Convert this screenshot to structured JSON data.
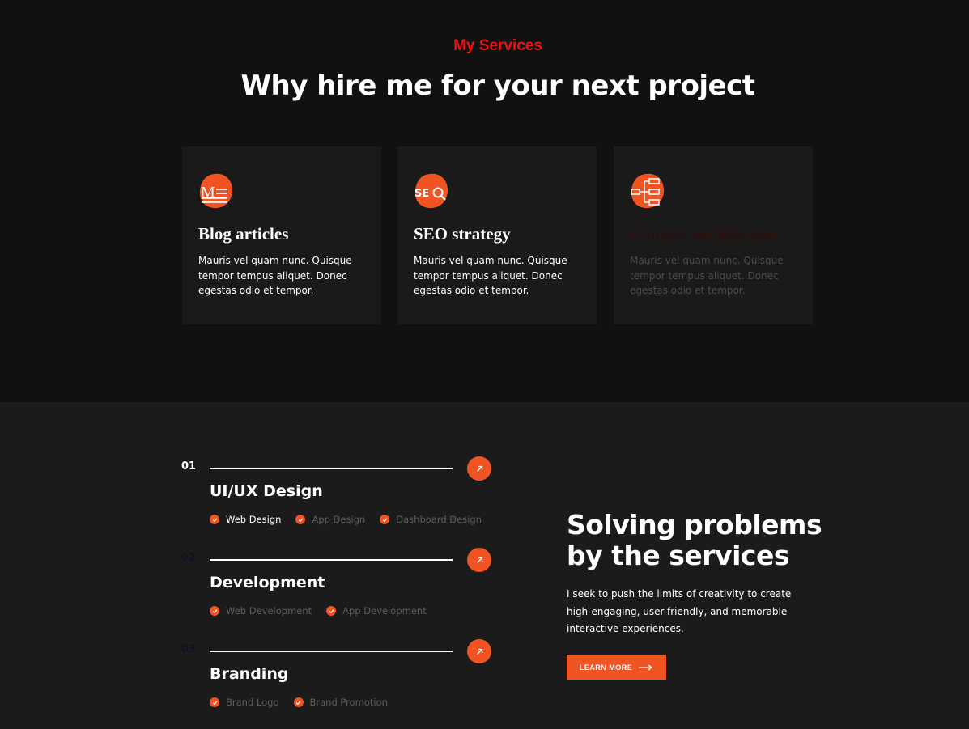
{
  "section_top": {
    "eyebrow": "My Services",
    "headline": "Why hire me for your next project"
  },
  "cards": [
    {
      "icon": "blog-icon",
      "title": "Blog articles",
      "text": "Mauris vel quam nunc. Quisque tempor tempus aliquet. Donec egestas odio et tempor."
    },
    {
      "icon": "seo-icon",
      "title": "SEO strategy",
      "text": "Mauris vel quam nunc. Quisque tempor tempus aliquet. Donec egestas odio et tempor."
    },
    {
      "icon": "architecture-icon",
      "title": "Content architecture",
      "text": "Mauris vel quam nunc. Quisque tempor tempus aliquet. Donec egestas odio et tempor."
    }
  ],
  "services": [
    {
      "number": "01",
      "title": "UI/UX Design",
      "tags": [
        "Web Design",
        "App Design",
        "Dashboard Design"
      ]
    },
    {
      "number": "02",
      "title": "Development",
      "tags": [
        "Web Development",
        "App Development"
      ]
    },
    {
      "number": "03",
      "title": "Branding",
      "tags": [
        "Brand Logo",
        "Brand Promotion"
      ]
    }
  ],
  "solve": {
    "heading_line1": "Solving problems",
    "heading_line2": "by the services",
    "text": "I seek to push the limits of creativity to create high-engaging, user-friendly, and memorable interactive experiences.",
    "button_label": "LEARN MORE"
  },
  "colors": {
    "accent": "#f05423",
    "eyebrow": "#e8130f",
    "background": "#111111",
    "card": "#1a1a1a"
  }
}
